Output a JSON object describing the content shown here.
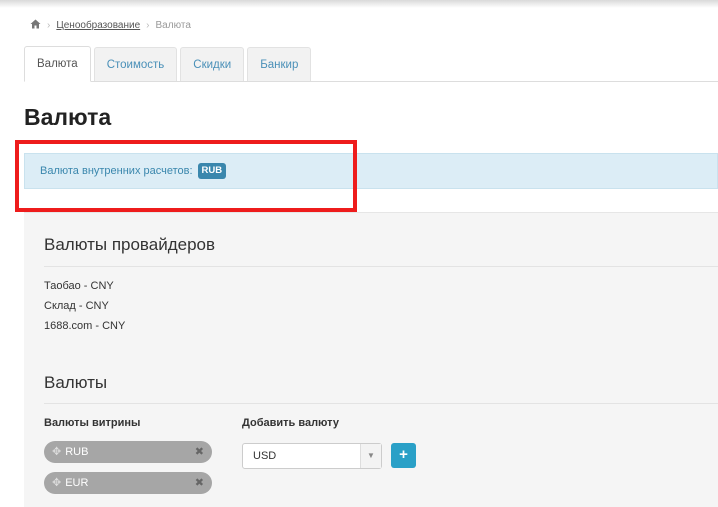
{
  "breadcrumb": {
    "home_icon": "home-icon",
    "separator": "›",
    "items": [
      "Ценообразование",
      "Валюта"
    ]
  },
  "tabs": [
    {
      "label": "Валюта",
      "active": true
    },
    {
      "label": "Стоимость",
      "active": false
    },
    {
      "label": "Скидки",
      "active": false
    },
    {
      "label": "Банкир",
      "active": false
    }
  ],
  "page": {
    "title": "Валюта"
  },
  "alert": {
    "text": "Валюта внутренних расчетов:",
    "badge": "RUB",
    "highlight_color": "#ee1c1c"
  },
  "providers": {
    "title": "Валюты провайдеров",
    "items": [
      "Таобао - CNY",
      "Склад - CNY",
      "1688.com - CNY"
    ]
  },
  "currencies": {
    "title": "Валюты",
    "storefront_label": "Валюты витрины",
    "storefront_items": [
      "RUB",
      "EUR"
    ],
    "move_icon": "move-icon",
    "remove_icon": "remove-icon",
    "add_label": "Добавить валюту",
    "select_value": "USD",
    "add_button": "+"
  },
  "colors": {
    "accent": "#3a87ad",
    "add_button": "#2aa0c7",
    "pill": "#a6a6a6"
  }
}
